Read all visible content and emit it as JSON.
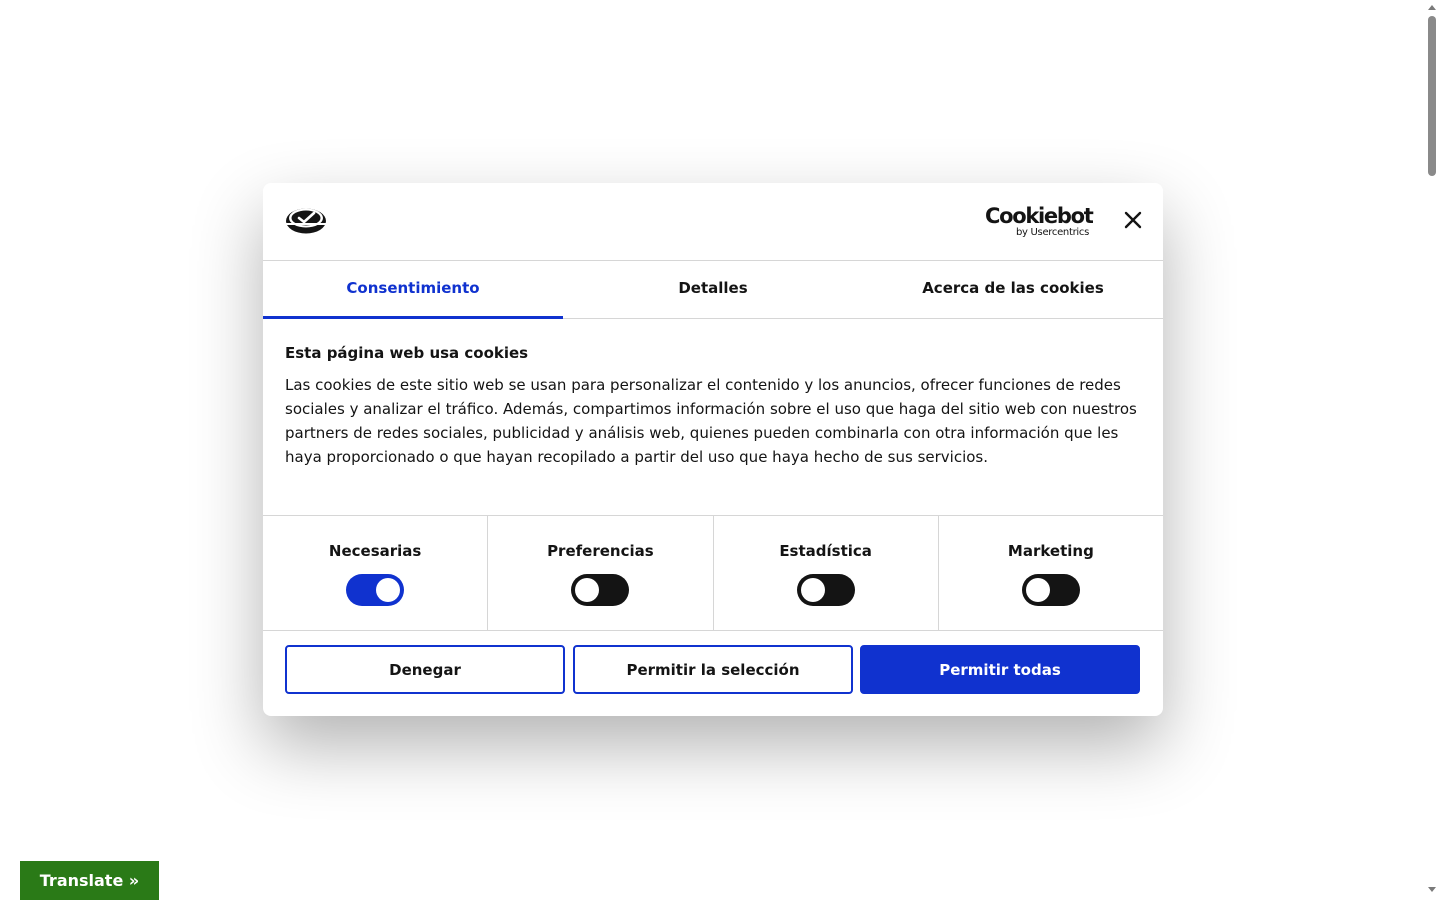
{
  "dialog": {
    "brand": {
      "name": "Cookiebot",
      "sub": "by Usercentrics"
    },
    "close_icon": "close-icon",
    "tabs": [
      {
        "label": "Consentimiento",
        "active": true
      },
      {
        "label": "Detalles",
        "active": false
      },
      {
        "label": "Acerca de las cookies",
        "active": false
      }
    ],
    "title": "Esta página web usa cookies",
    "description": "Las cookies de este sitio web se usan para personalizar el contenido y los anuncios, ofrecer funciones de redes sociales y analizar el tráfico. Además, compartimos información sobre el uso que haga del sitio web con nuestros partners de redes sociales, publicidad y análisis web, quienes pueden combinarla con otra información que les haya proporcionado o que hayan recopilado a partir del uso que haya hecho de sus servicios.",
    "toggles": [
      {
        "label": "Necesarias",
        "on": true
      },
      {
        "label": "Preferencias",
        "on": false
      },
      {
        "label": "Estadística",
        "on": false
      },
      {
        "label": "Marketing",
        "on": false
      }
    ],
    "buttons": {
      "deny": "Denegar",
      "selection": "Permitir la selección",
      "all": "Permitir todas"
    }
  },
  "translate": {
    "label": "Translate »"
  },
  "colors": {
    "accent": "#1032cf",
    "text": "#141414",
    "translate_bg": "#2a7a17"
  }
}
